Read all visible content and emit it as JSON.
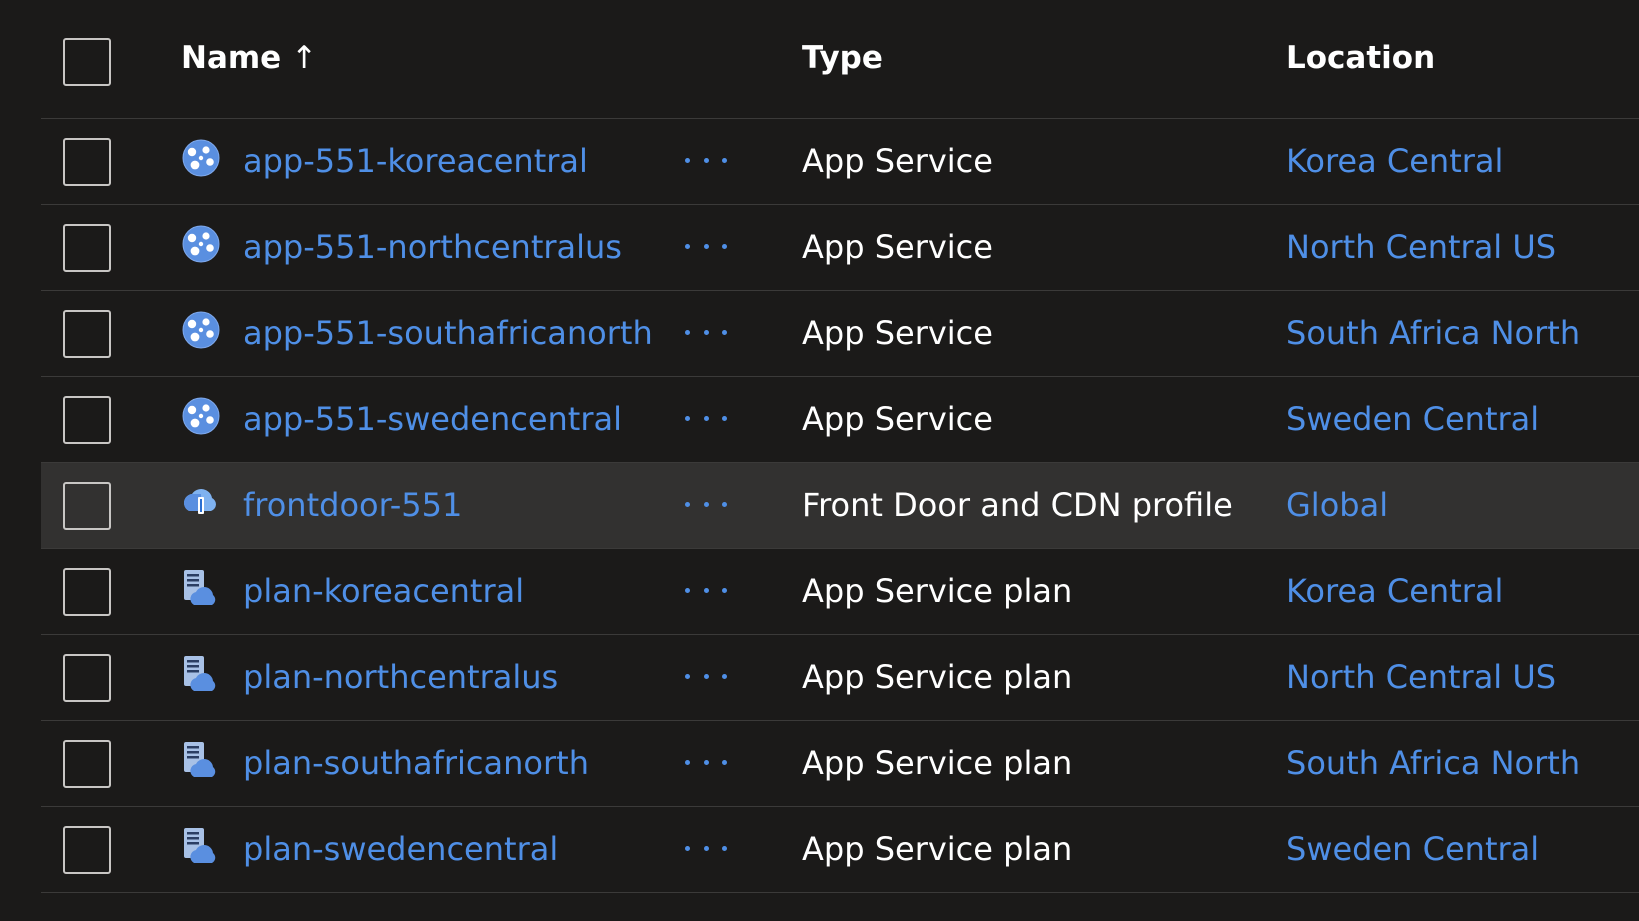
{
  "header": {
    "name_label": "Name",
    "sort_indicator": "↑",
    "type_label": "Type",
    "location_label": "Location"
  },
  "colors": {
    "background": "#1b1a19",
    "link": "#4f8fe6",
    "selected_row": "#323130",
    "divider": "#3b3a39"
  },
  "rows": [
    {
      "name": "app-551-koreacentral",
      "icon": "app-service-icon",
      "type": "App Service",
      "location": "Korea Central",
      "selected": false
    },
    {
      "name": "app-551-northcentralus",
      "icon": "app-service-icon",
      "type": "App Service",
      "location": "North Central US",
      "selected": false
    },
    {
      "name": "app-551-southafricanorth",
      "icon": "app-service-icon",
      "type": "App Service",
      "location": "South Africa North",
      "selected": false
    },
    {
      "name": "app-551-swedencentral",
      "icon": "app-service-icon",
      "type": "App Service",
      "location": "Sweden Central",
      "selected": false
    },
    {
      "name": "frontdoor-551",
      "icon": "front-door-icon",
      "type": "Front Door and CDN profile",
      "location": "Global",
      "selected": true
    },
    {
      "name": "plan-koreacentral",
      "icon": "app-service-plan-icon",
      "type": "App Service plan",
      "location": "Korea Central",
      "selected": false
    },
    {
      "name": "plan-northcentralus",
      "icon": "app-service-plan-icon",
      "type": "App Service plan",
      "location": "North Central US",
      "selected": false
    },
    {
      "name": "plan-southafricanorth",
      "icon": "app-service-plan-icon",
      "type": "App Service plan",
      "location": "South Africa North",
      "selected": false
    },
    {
      "name": "plan-swedencentral",
      "icon": "app-service-plan-icon",
      "type": "App Service plan",
      "location": "Sweden Central",
      "selected": false
    }
  ]
}
